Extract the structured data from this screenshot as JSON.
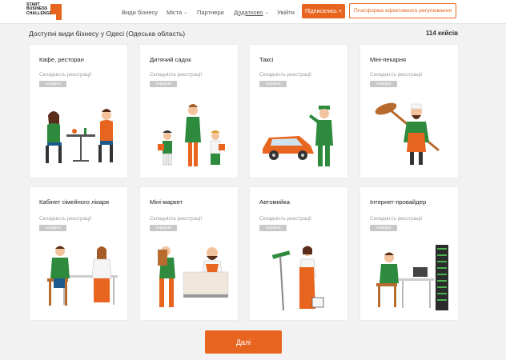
{
  "header": {
    "logo_text": "START BUSINESS CHALLENGE",
    "nav": [
      {
        "label": "Види бізнесу",
        "caret": false
      },
      {
        "label": "Міста",
        "caret": true
      },
      {
        "label": "Партнери",
        "caret": false
      },
      {
        "label": "Додатково",
        "caret": true
      },
      {
        "label": "Увійти",
        "caret": false
      }
    ],
    "subscribe_label": "Підписатись",
    "platform_label": "Платформа ефективного регулювання"
  },
  "main": {
    "heading": "Доступні види бізнесу у Одесі (Одеська область)",
    "count": "114 кейсів",
    "cards": [
      {
        "title": "Кафе, ресторан",
        "subtitle": "Складність реєстрації",
        "badge": "середня"
      },
      {
        "title": "Дитячий садок",
        "subtitle": "Складність реєстрації",
        "badge": "середня"
      },
      {
        "title": "Таксі",
        "subtitle": "Складність реєстрації",
        "badge": "середня"
      },
      {
        "title": "Міні-пекарня",
        "subtitle": "Складність реєстрації",
        "badge": "середня"
      },
      {
        "title": "Кабінет сімейного лікаря",
        "subtitle": "Складність реєстрації",
        "badge": "середня"
      },
      {
        "title": "Міні-маркет",
        "subtitle": "Складність реєстрації",
        "badge": "середня"
      },
      {
        "title": "Автомийка",
        "subtitle": "Складність реєстрації",
        "badge": "середня"
      },
      {
        "title": "Інтернет-провайдер",
        "subtitle": "Складність реєстрації",
        "badge": "середня"
      }
    ],
    "next_label": "Далі"
  },
  "colors": {
    "accent": "#e8651f",
    "green": "#2e8b3e",
    "page_bg": "#f2f2f2"
  }
}
